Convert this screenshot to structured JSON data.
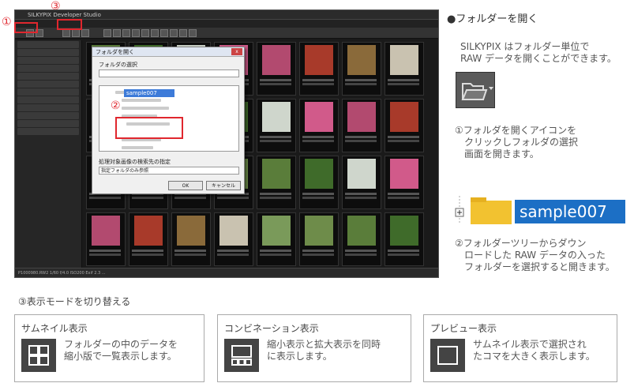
{
  "app": {
    "title": "SILKYPIX Developer Studio",
    "status_text": "P1000980.RW2 1/60 f/4.0 ISO200 Exif 2.3 ..."
  },
  "dialog": {
    "title": "フォルダを開く",
    "select_label": "フォルダの選択",
    "selected_folder": "sample007",
    "filter_label": "処理対象画像の検索先の指定",
    "filter_value": "指定フォルダのみ参照",
    "ok_label": "OK",
    "cancel_label": "キャンセル"
  },
  "annotations": {
    "one": "①",
    "two": "②",
    "three": "③"
  },
  "right": {
    "heading": "●フォルダーを開く",
    "intro_line1": "SILKYPIX はフォルダー単位で",
    "intro_line2": "RAW データを開くことができます。",
    "step1_line1": "①フォルダを開くアイコンを",
    "step1_line2": "クリックしフォルダの選択",
    "step1_line3": "画面を開きます。",
    "sample_label": "sample007",
    "step2_line1": "②フォルダーツリーからダウン",
    "step2_line2": "ロードした RAW データの入った",
    "step2_line3": "フォルダーを選択すると開きます。"
  },
  "modes": {
    "heading": "③表示モードを切り替える",
    "cards": [
      {
        "title": "サムネイル表示",
        "desc_line1": "フォルダーの中のデータを",
        "desc_line2": "縮小版で一覧表示します。",
        "icon": "grid-icon"
      },
      {
        "title": "コンビネーション表示",
        "desc_line1": "縮小表示と拡大表示を同時",
        "desc_line2": "に表示します。",
        "icon": "combination-icon"
      },
      {
        "title": "プレビュー表示",
        "desc_line1": "サムネイル表示で選択され",
        "desc_line2": "たコマを大きく表示します。",
        "icon": "preview-icon"
      }
    ]
  },
  "colors": {
    "accent_red": "#e0272e",
    "selection_blue": "#1c6fc5"
  }
}
